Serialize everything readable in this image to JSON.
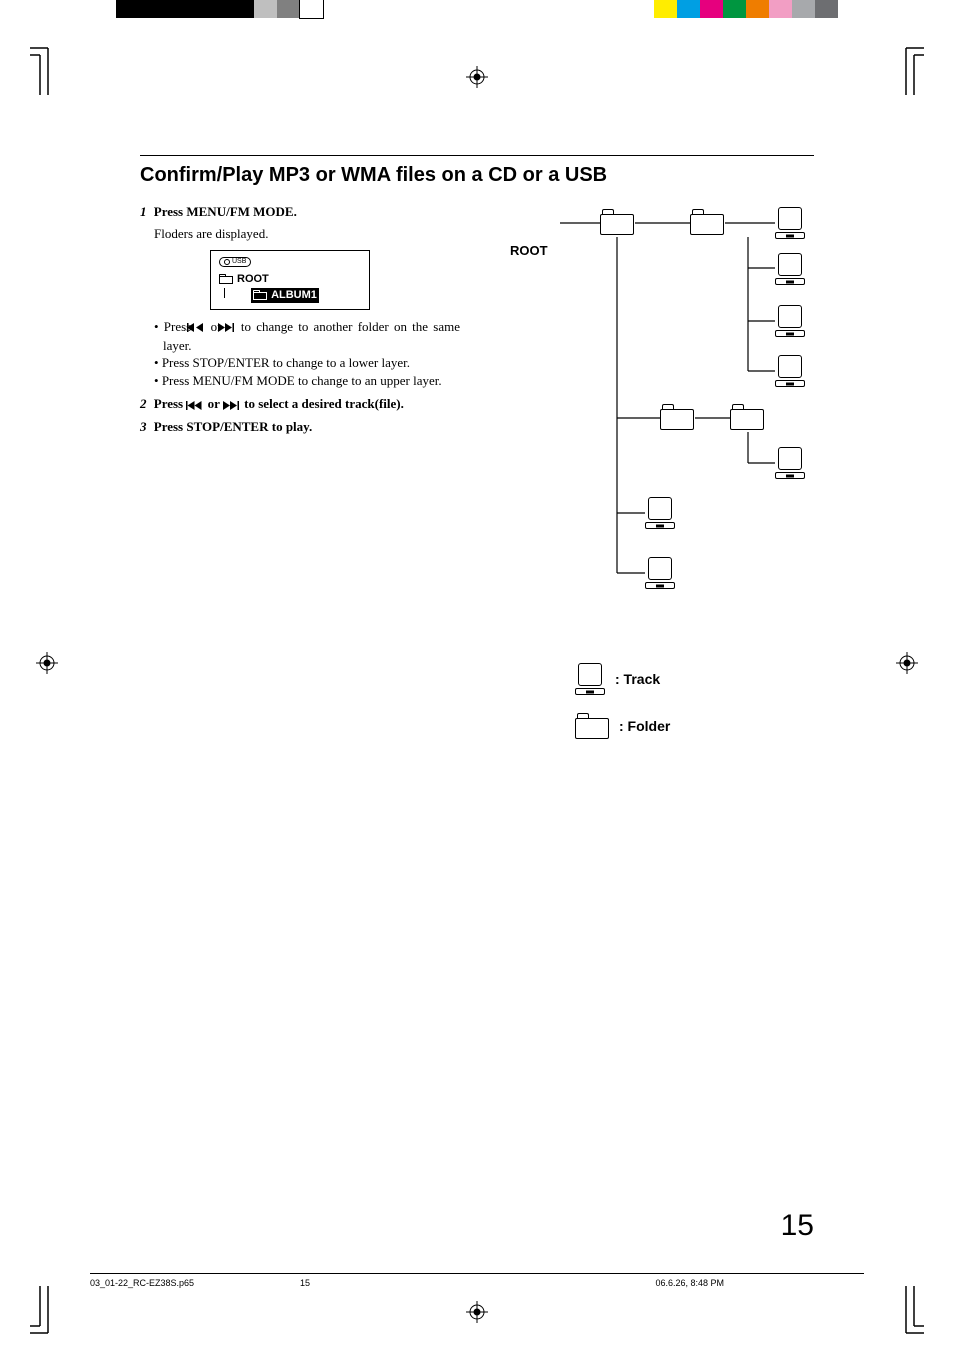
{
  "section_title": "Confirm/Play MP3 or WMA files on a CD or a USB",
  "step1": {
    "num": "1",
    "bold": "Press MENU/FM MODE.",
    "sub": "Floders are displayed."
  },
  "lcd": {
    "usb": "USB",
    "root": "ROOT",
    "album": "ALBUM1"
  },
  "bullets": {
    "b1a": "Press ",
    "b1b": " or ",
    "b1c": " to change to another folder on the same layer.",
    "b2": "Press STOP/ENTER to change to a lower layer.",
    "b3": "Press MENU/FM MODE to change to an upper layer."
  },
  "step2": {
    "num": "2",
    "a": "Press ",
    "b": " or ",
    "c": " to select a desired track(file)."
  },
  "step3": {
    "num": "3",
    "text": "Press STOP/ENTER to play."
  },
  "tree": {
    "root": "ROOT"
  },
  "legend": {
    "track": ": Track",
    "folder": ": Folder"
  },
  "page_number": "15",
  "footer": {
    "file": "03_01-22_RC-EZ38S.p65",
    "page": "15",
    "date": "06.6.26, 8:48 PM"
  },
  "colorbar_left": [
    "#000",
    "#000",
    "#000",
    "#000",
    "#000",
    "#000",
    "#bfbfbf",
    "#808080",
    "#fff"
  ],
  "colorbar_right": [
    "#ffed00",
    "#009fe3",
    "#e6007e",
    "#009640",
    "#ef7d00",
    "#f29ec4",
    "#a7a9ac",
    "#6d6e71"
  ]
}
